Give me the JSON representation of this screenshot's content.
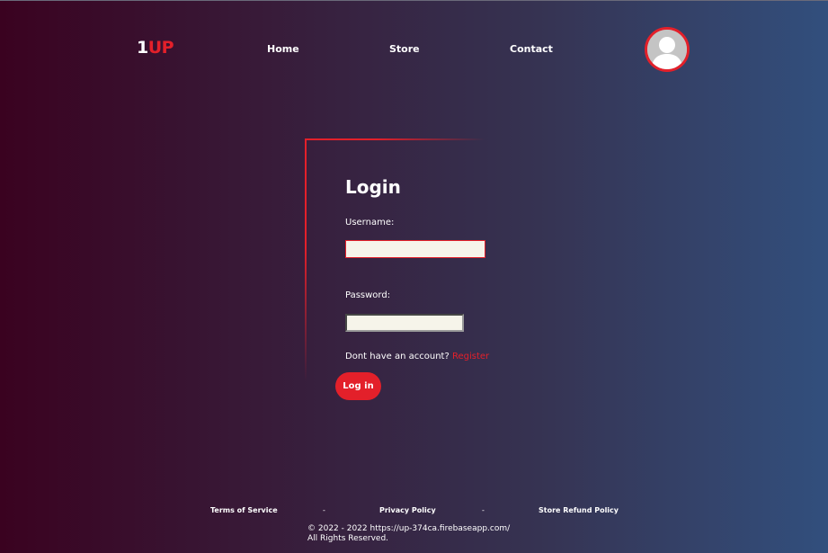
{
  "header": {
    "logo_part1": "1",
    "logo_part2": "UP",
    "nav": {
      "home": "Home",
      "store": "Store",
      "contact": "Contact"
    },
    "avatar_icon": "user-avatar-icon"
  },
  "login": {
    "title": "Login",
    "username_label": "Username:",
    "username_value": "",
    "password_label": "Password:",
    "password_value": "",
    "no_account_text": "Dont have an account?",
    "register_link": "Register",
    "login_button": "Log in"
  },
  "footer": {
    "terms": "Terms of Service",
    "separator": "-",
    "privacy": "Privacy Policy",
    "refund": "Store Refund Policy",
    "copyright_line1": "© 2022 - 2022 https://up-374ca.firebaseapp.com/",
    "copyright_line2": "All Rights Reserved."
  },
  "colors": {
    "accent": "#e3202a",
    "input_background": "#f6f4ea"
  }
}
